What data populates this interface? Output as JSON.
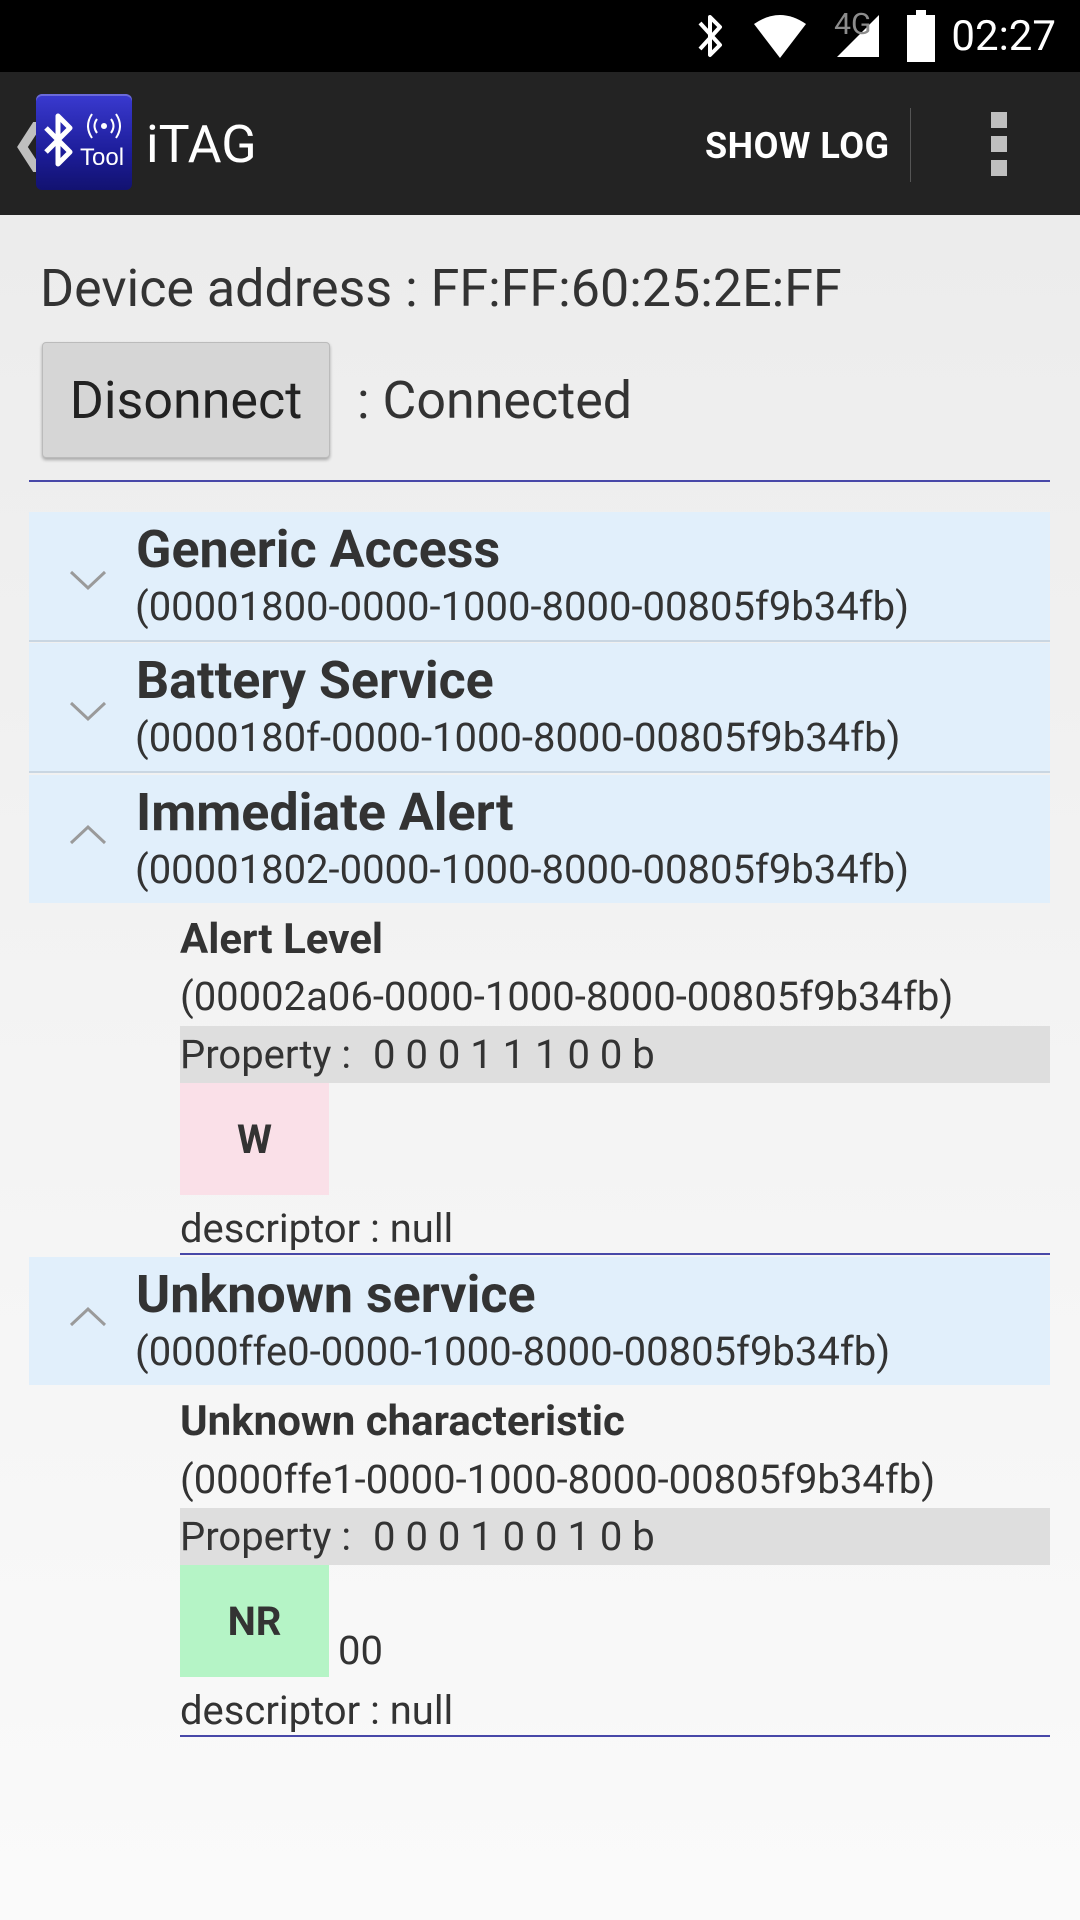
{
  "status_bar": {
    "time": "02:27",
    "network_label": "4G",
    "icons": [
      "bluetooth-icon",
      "wifi-icon",
      "cellular-signal-icon",
      "battery-icon"
    ]
  },
  "app_bar": {
    "title": "iTAG",
    "back_icon": "chevron-left-icon",
    "app_icon": "bluetooth-tool-icon",
    "app_icon_text": "Tool",
    "show_log_label": "SHOW LOG",
    "overflow_icon": "overflow-menu-icon"
  },
  "device": {
    "address_text": "Device address : FF:FF:60:25:2E:FF",
    "disconnect_label": "Disonnect",
    "status_text": ": Connected"
  },
  "services": [
    {
      "name": "Generic Access",
      "uuid": "(00001800-0000-1000-8000-00805f9b34fb)",
      "expanded": false
    },
    {
      "name": "Battery Service",
      "uuid": "(0000180f-0000-1000-8000-00805f9b34fb)",
      "expanded": false
    },
    {
      "name": "Immediate Alert",
      "uuid": "(00001802-0000-1000-8000-00805f9b34fb)",
      "expanded": true,
      "characteristic": {
        "name": "Alert Level",
        "uuid": "(00002a06-0000-1000-8000-00805f9b34fb)",
        "property_label": "Property :",
        "property_bits": "0 0 0 1 1 1 0 0 b",
        "button_label": "W",
        "button_color": "#fae0e8",
        "value": "",
        "descriptor": "descriptor : null"
      }
    },
    {
      "name": "Unknown service",
      "uuid": "(0000ffe0-0000-1000-8000-00805f9b34fb)",
      "expanded": true,
      "characteristic": {
        "name": "Unknown characteristic",
        "uuid": "(0000ffe1-0000-1000-8000-00805f9b34fb)",
        "property_label": "Property :",
        "property_bits": "0 0 0 1 0 0 1 0 b",
        "button_label": "NR",
        "button_color": "#b5f4c6",
        "value": "00",
        "descriptor": "descriptor : null"
      }
    }
  ],
  "colors": {
    "service_header_bg": "#e1effb",
    "divider": "#4848a8",
    "app_bar": "#232323"
  }
}
